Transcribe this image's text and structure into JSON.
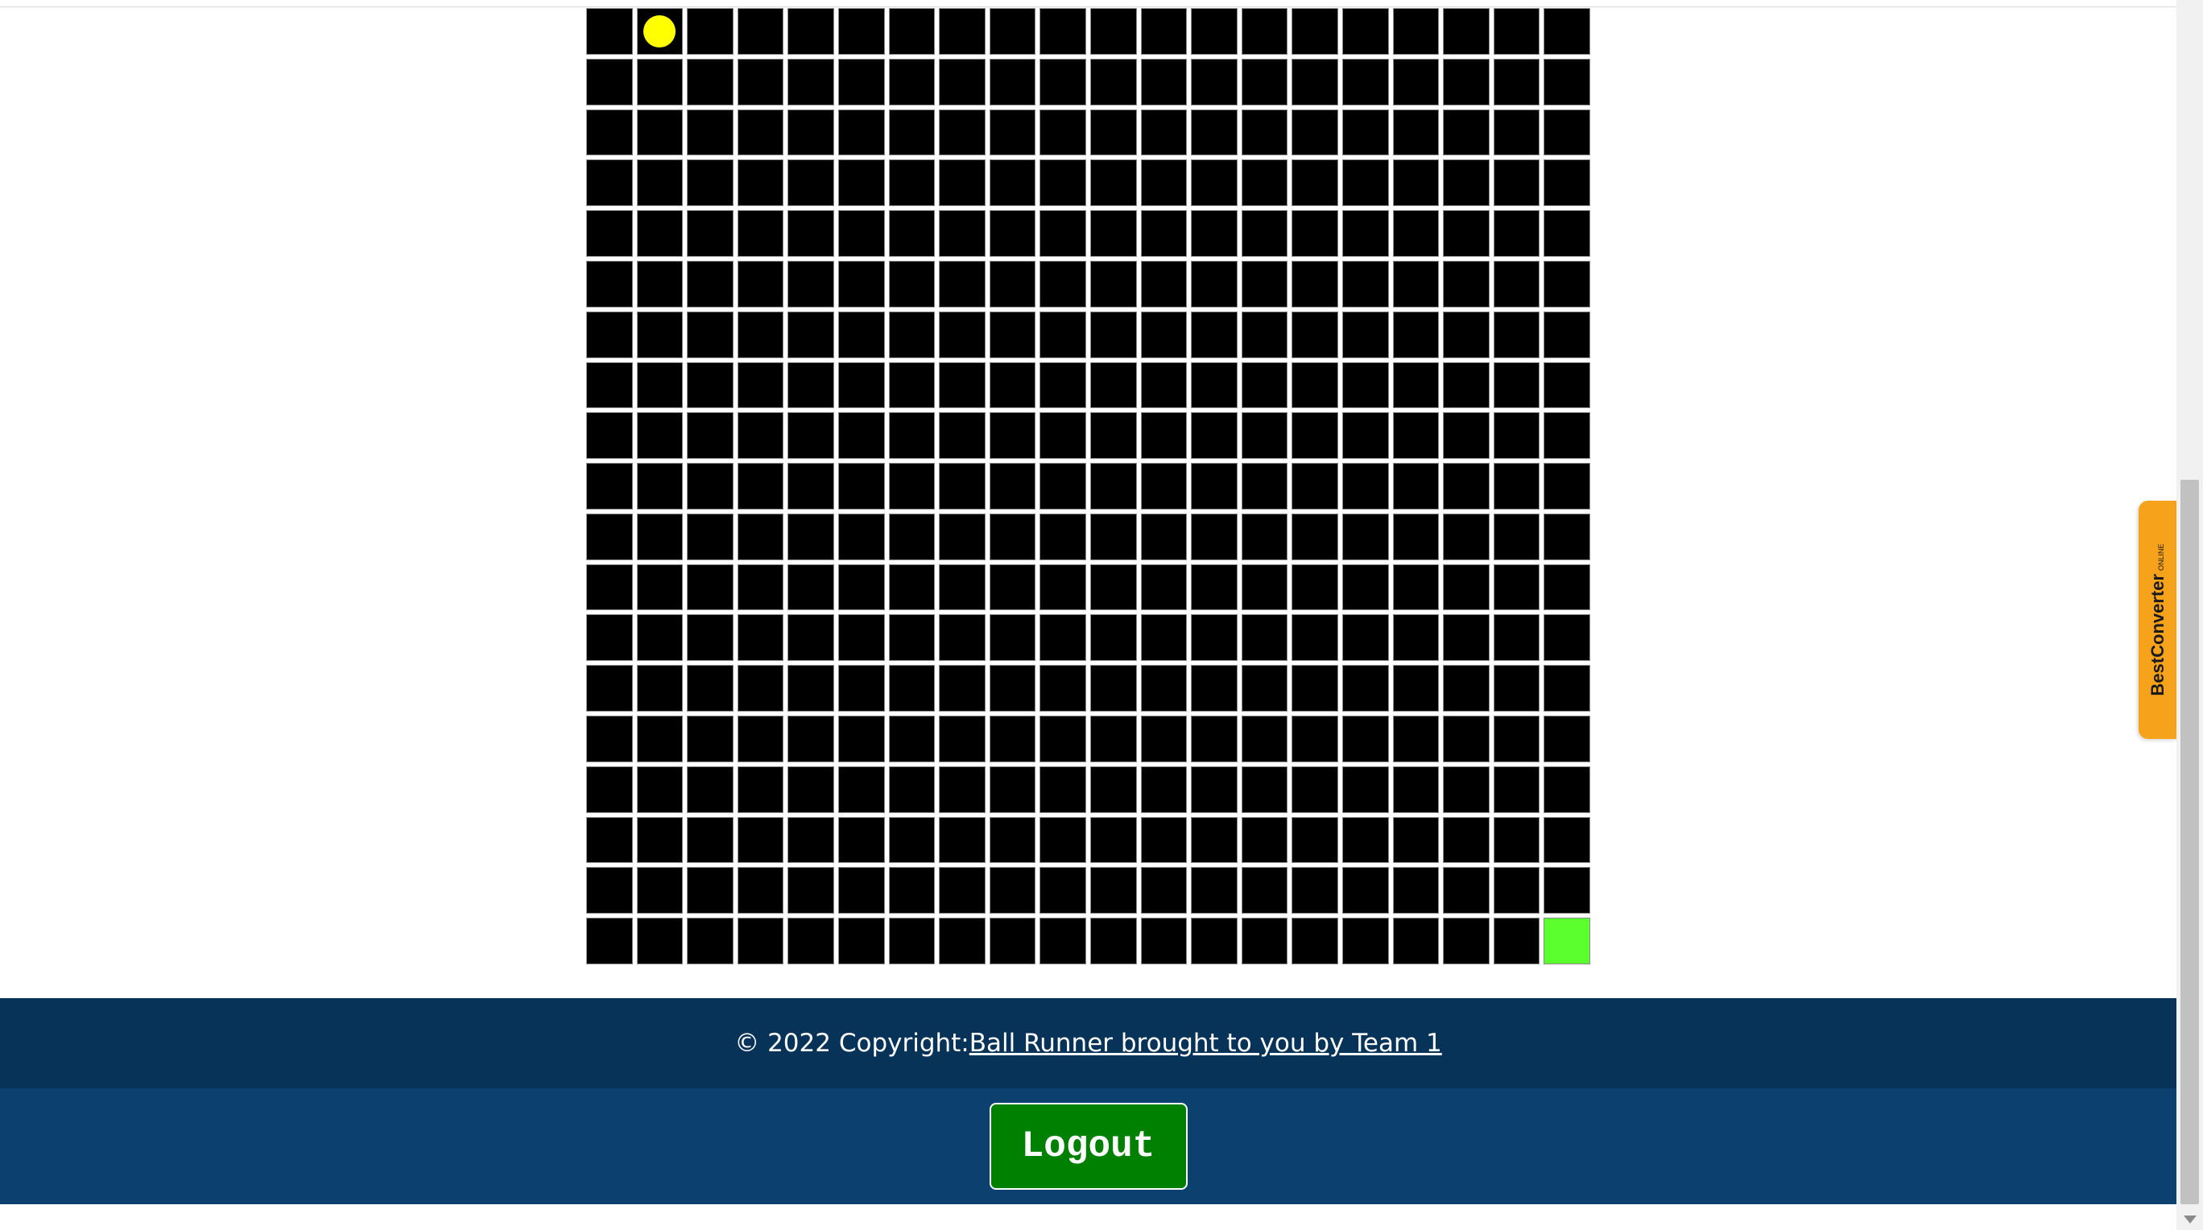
{
  "game": {
    "columns": 20,
    "rows": 19,
    "ball_cell": [
      0,
      1
    ],
    "goal_cell": [
      18,
      19
    ],
    "colors": {
      "cell": "#000000",
      "ball": "#ffff00",
      "goal": "#5cff2e"
    }
  },
  "footer": {
    "copyright_prefix": "© 2022 Copyright:",
    "copyright_link": "Ball Runner brought to you by Team 1",
    "logout_label": "Logout"
  },
  "extension_tab": {
    "brand": "BestConverter",
    "subtitle": "ONLINE"
  }
}
